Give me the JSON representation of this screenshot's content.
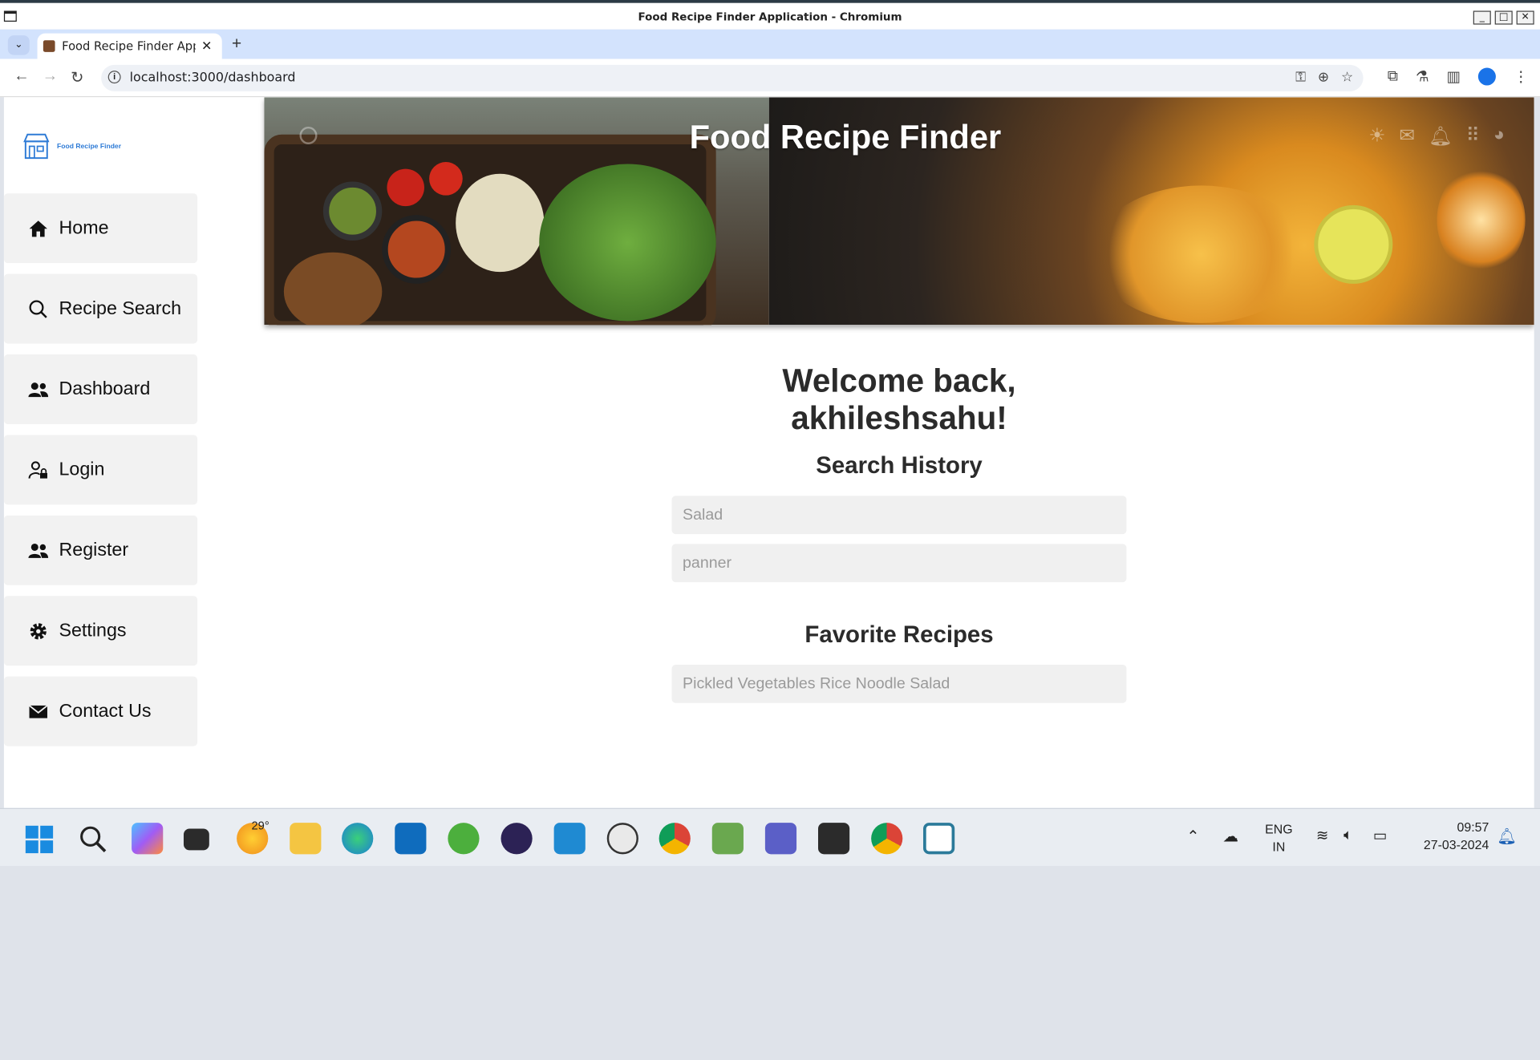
{
  "window": {
    "title": "Food Recipe Finder Application - Chromium"
  },
  "browser": {
    "tab_title": "Food Recipe Finder Applic",
    "url": "localhost:3000/dashboard"
  },
  "app": {
    "brand": "Food Recipe Finder",
    "hero_title": "Food Recipe Finder",
    "sidebar": [
      {
        "label": "Home",
        "icon": "home-icon"
      },
      {
        "label": "Recipe Search",
        "icon": "search-icon"
      },
      {
        "label": "Dashboard",
        "icon": "users-icon"
      },
      {
        "label": "Login",
        "icon": "user-lock-icon"
      },
      {
        "label": "Register",
        "icon": "users-icon"
      },
      {
        "label": "Settings",
        "icon": "gear-icon"
      },
      {
        "label": "Contact Us",
        "icon": "envelope-icon"
      }
    ],
    "welcome": "Welcome back, akhileshsahu!",
    "search_history": {
      "heading": "Search History",
      "items": [
        "Salad",
        "panner"
      ]
    },
    "favorites": {
      "heading": "Favorite Recipes",
      "items": [
        "Pickled Vegetables Rice Noodle Salad"
      ]
    }
  },
  "taskbar": {
    "weather": "29°",
    "lang_top": "ENG",
    "lang_bottom": "IN",
    "time": "09:57",
    "date": "27-03-2024"
  }
}
